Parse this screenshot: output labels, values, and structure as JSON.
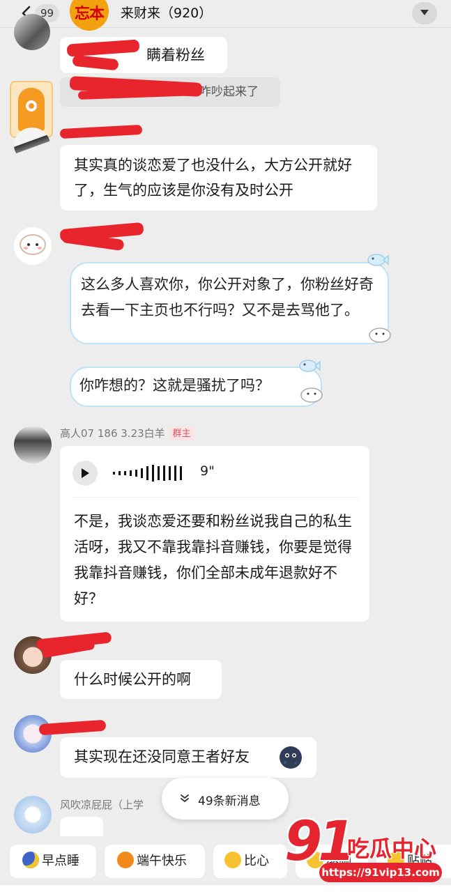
{
  "header": {
    "back_count": "99",
    "group_logo_text": "忘本",
    "title": "来财来（920）"
  },
  "messages": {
    "m1": "瞒着粉丝",
    "m2": "咋吵起来了",
    "m3": "其实真的谈恋爱了也没什么，大方公开就好了，生气的应该是你没有及时公开",
    "m4": "这么多人喜欢你，你公开对象了，你粉丝好奇去看一下主页也不行吗？又不是去骂他了。",
    "m5": "你咋想的？这就是骚扰了吗？",
    "m6_sender": "高人07  186  3.23白羊",
    "m6_badge": "群主",
    "m6_voice_duration": "9\"",
    "m6_text": "不是，我谈恋爱还要和粉丝说我自己的私生活呀，我又不靠我靠抖音赚钱，你要是觉得我靠抖音赚钱，你们全部未成年退款好不好？",
    "m7": "什么时候公开的啊",
    "m8": "其实现在还没同意王者好友",
    "m9_sender": "风吹凉屁屁（上学"
  },
  "new_messages": "49条新消息",
  "quick_chips": [
    "早点睡",
    "端午快乐",
    "比心",
    "熬脚",
    "贴贴"
  ],
  "watermark": {
    "logo_number": "91",
    "logo_text": "吃瓜中心",
    "url": "https://91vip13.com"
  },
  "colors": {
    "background": "#ededed",
    "bubble": "#ffffff",
    "redaction": "#e8252c",
    "badge_text": "#e2515f",
    "watermark": "#e4252f"
  },
  "icons": [
    "back-chevron-icon",
    "menu-down-icon",
    "play-icon",
    "voice-wave-icon",
    "double-chevron-down-icon",
    "emoji-icon"
  ]
}
